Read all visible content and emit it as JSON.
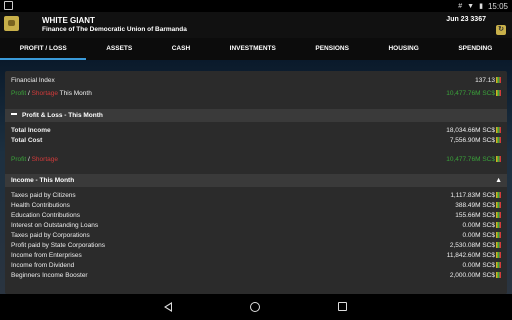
{
  "status_bar": {
    "time": "15:05",
    "icons": [
      "notification-icon",
      "hash-icon",
      "wifi-icon",
      "battery-icon"
    ]
  },
  "header": {
    "title": "WHITE GIANT",
    "subtitle": "Finance of The Democratic Union of Barmanda",
    "date": "Jun 23 3367"
  },
  "tabs": [
    {
      "label": "PROFIT / LOSS",
      "active": true
    },
    {
      "label": "ASSETS"
    },
    {
      "label": "CASH"
    },
    {
      "label": "INVESTMENTS"
    },
    {
      "label": "PENSIONS"
    },
    {
      "label": "HOUSING"
    },
    {
      "label": "SPENDING"
    }
  ],
  "summary": {
    "financial_index_label": "Financial Index",
    "financial_index_value": "137.13",
    "profit_word": "Profit",
    "slash": " / ",
    "shortage_word": "Shortage",
    "this_month": " This Month",
    "profit_value": "10,477.76M SC$"
  },
  "pl_section": {
    "title": "Profit & Loss - This Month",
    "total_income_label": "Total Income",
    "total_income_value": "18,034.66M SC$",
    "total_cost_label": "Total Cost",
    "total_cost_value": "7,556.90M SC$",
    "profit_word": "Profit",
    "slash": " / ",
    "shortage_word": "Shortage",
    "profit_value": "10,477.76M SC$"
  },
  "income_section": {
    "title": "Income - This Month",
    "rows": [
      {
        "label": "Taxes paid by Citizens",
        "value": "1,117.83M SC$"
      },
      {
        "label": "Health Contributions",
        "value": "388.49M SC$"
      },
      {
        "label": "Education Contributions",
        "value": "155.66M SC$"
      },
      {
        "label": "Interest on Outstanding Loans",
        "value": "0.00M SC$"
      },
      {
        "label": "Taxes paid by Corporations",
        "value": "0.00M SC$"
      },
      {
        "label": "Profit paid by State Corporations",
        "value": "2,530.08M SC$"
      },
      {
        "label": "Income from Enterprises",
        "value": "11,842.60M SC$"
      },
      {
        "label": "Income from Dividend",
        "value": "0.00M SC$"
      },
      {
        "label": "Beginners Income Booster",
        "value": "2,000.00M SC$"
      }
    ]
  },
  "colors": {
    "profit_green": "#3aa33a",
    "shortage_red": "#d23a3a",
    "tab_accent": "#3a9ad9"
  }
}
